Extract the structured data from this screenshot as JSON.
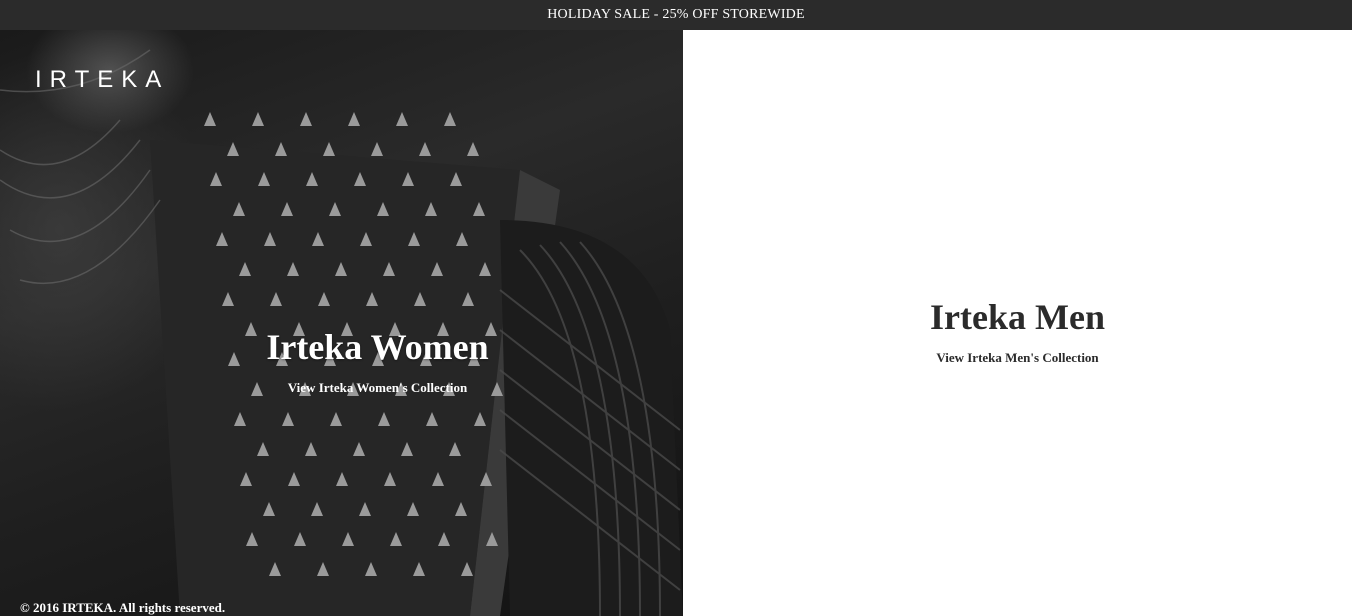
{
  "promo": {
    "text": "HOLIDAY SALE - 25% OFF STOREWIDE"
  },
  "brand": {
    "logo": "IRTEKA"
  },
  "women": {
    "title": "Irteka Women",
    "link": "View Irteka Women's Collection",
    "image": "studded-leather-jacket-photo"
  },
  "men": {
    "title": "Irteka Men",
    "link": "View Irteka Men's Collection"
  },
  "footer": {
    "copyright": "© 2016 IRTEKA. All rights reserved."
  },
  "colors": {
    "promo_bg": "#2b2b2b",
    "text_dark": "#2b2b2b",
    "text_light": "#ffffff"
  }
}
